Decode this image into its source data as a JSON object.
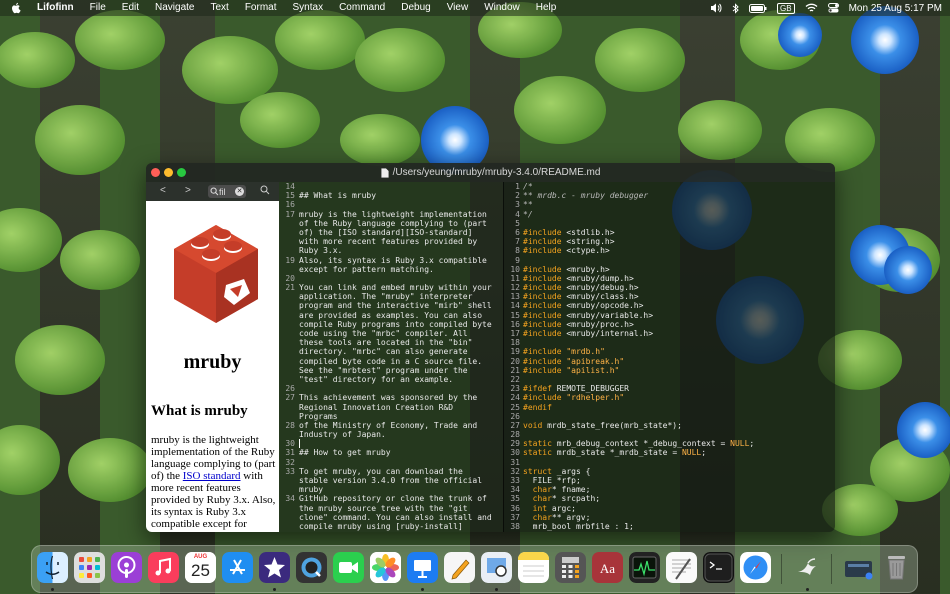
{
  "menubar": {
    "app_name": "Lifofinn",
    "menus": [
      "File",
      "Edit",
      "Navigate",
      "Text",
      "Format",
      "Syntax",
      "Command",
      "Debug",
      "View",
      "Window",
      "Help"
    ],
    "keyboard_layout": "GB",
    "clock": "Mon 25 Aug  5:17 PM"
  },
  "window": {
    "title": "/Users/yeung/mruby/mruby-3.4.0/README.md"
  },
  "preview": {
    "nav": {
      "back": "<",
      "forward": ">",
      "find_value": "fil"
    },
    "logo_title": "mruby",
    "heading": "What is mruby",
    "body_before_link1": "mruby is the lightweight implementation of the Ruby language complying to (part of) the ",
    "link1": "ISO standard",
    "body_after_link1": " with more recent features provided by Ruby 3.x. Also, its syntax is Ruby 3.x compatible except for"
  },
  "markdown_editor": {
    "lines": [
      {
        "n": "14",
        "t": ""
      },
      {
        "n": "15",
        "t": "## What is mruby"
      },
      {
        "n": "16",
        "t": ""
      },
      {
        "n": "17",
        "t": "mruby is the lightweight implementation"
      },
      {
        "n": "",
        "t": "of the Ruby language complying to (part"
      },
      {
        "n": "",
        "t": "of) the [ISO standard][ISO-standard]"
      },
      {
        "n": "",
        "t": "with more recent features provided by"
      },
      {
        "n": "",
        "t": "Ruby 3.x."
      },
      {
        "n": "19",
        "t": "Also, its syntax is Ruby 3.x compatible"
      },
      {
        "n": "",
        "t": "except for pattern matching."
      },
      {
        "n": "20",
        "t": ""
      },
      {
        "n": "21",
        "t": "You can link and embed mruby within your"
      },
      {
        "n": "",
        "t": "application. The \"mruby\" interpreter"
      },
      {
        "n": "",
        "t": "program and the interactive \"mirb\" shell"
      },
      {
        "n": "",
        "t": "are provided as examples. You can also"
      },
      {
        "n": "",
        "t": "compile Ruby programs into compiled byte"
      },
      {
        "n": "",
        "t": "code using the \"mrbc\" compiler. All"
      },
      {
        "n": "",
        "t": "these tools are located in the \"bin\""
      },
      {
        "n": "",
        "t": "directory. \"mrbc\" can also generate"
      },
      {
        "n": "",
        "t": "compiled byte code in a C source file."
      },
      {
        "n": "",
        "t": "See the \"mrbtest\" program under the"
      },
      {
        "n": "",
        "t": "\"test\" directory for an example."
      },
      {
        "n": "26",
        "t": ""
      },
      {
        "n": "27",
        "t": "This achievement was sponsored by the"
      },
      {
        "n": "",
        "t": "Regional Innovation Creation R&D"
      },
      {
        "n": "",
        "t": "Programs"
      },
      {
        "n": "28",
        "t": "of the Ministry of Economy, Trade and"
      },
      {
        "n": "",
        "t": "Industry of Japan."
      },
      {
        "n": "30",
        "t": ""
      },
      {
        "n": "31",
        "t": "## How to get mruby"
      },
      {
        "n": "32",
        "t": ""
      },
      {
        "n": "33",
        "t": "To get mruby, you can download the"
      },
      {
        "n": "",
        "t": "stable version 3.4.0 from the official"
      },
      {
        "n": "",
        "t": "mruby"
      },
      {
        "n": "34",
        "t": "GitHub repository or clone the trunk of"
      },
      {
        "n": "",
        "t": "the mruby source tree with the \"git"
      },
      {
        "n": "",
        "t": "clone\" command. You can also install and"
      },
      {
        "n": "",
        "t": "compile mruby using [ruby-install]"
      },
      {
        "n": "",
        "t": "(https://github.com/postmodern/ruby-"
      }
    ]
  },
  "c_editor": {
    "line_numbers": [
      "1",
      "2",
      "3",
      "4",
      "5",
      "6",
      "7",
      "8",
      "9",
      "10",
      "11",
      "12",
      "13",
      "14",
      "15",
      "16",
      "17",
      "18",
      "19",
      "20",
      "21",
      "22",
      "23",
      "24",
      "25",
      "26",
      "27",
      "28",
      "29",
      "30",
      "31",
      "32",
      "33",
      "34",
      "35",
      "36",
      "37",
      "38"
    ],
    "lines": [
      [
        {
          "c": "cm",
          "t": "/*"
        }
      ],
      [
        {
          "c": "cm",
          "t": "** mrdb.c - mruby debugger"
        }
      ],
      [
        {
          "c": "cm",
          "t": "**"
        }
      ],
      [
        {
          "c": "cm",
          "t": "*/"
        }
      ],
      [],
      [
        {
          "c": "inc",
          "t": "#include"
        },
        {
          "c": "",
          "t": " <stdlib.h>"
        }
      ],
      [
        {
          "c": "inc",
          "t": "#include"
        },
        {
          "c": "",
          "t": " <string.h>"
        }
      ],
      [
        {
          "c": "inc",
          "t": "#include"
        },
        {
          "c": "",
          "t": " <ctype.h>"
        }
      ],
      [],
      [
        {
          "c": "inc",
          "t": "#include"
        },
        {
          "c": "",
          "t": " <mruby.h>"
        }
      ],
      [
        {
          "c": "inc",
          "t": "#include"
        },
        {
          "c": "",
          "t": " <mruby/dump.h>"
        }
      ],
      [
        {
          "c": "inc",
          "t": "#include"
        },
        {
          "c": "",
          "t": " <mruby/debug.h>"
        }
      ],
      [
        {
          "c": "inc",
          "t": "#include"
        },
        {
          "c": "",
          "t": " <mruby/class.h>"
        }
      ],
      [
        {
          "c": "inc",
          "t": "#include"
        },
        {
          "c": "",
          "t": " <mruby/opcode.h>"
        }
      ],
      [
        {
          "c": "inc",
          "t": "#include"
        },
        {
          "c": "",
          "t": " <mruby/variable.h>"
        }
      ],
      [
        {
          "c": "inc",
          "t": "#include"
        },
        {
          "c": "",
          "t": " <mruby/proc.h>"
        }
      ],
      [
        {
          "c": "inc",
          "t": "#include"
        },
        {
          "c": "",
          "t": " <mruby/internal.h>"
        }
      ],
      [],
      [
        {
          "c": "inc",
          "t": "#include"
        },
        {
          "c": "str",
          "t": " \"mrdb.h\""
        }
      ],
      [
        {
          "c": "inc",
          "t": "#include"
        },
        {
          "c": "str",
          "t": " \"apibreak.h\""
        }
      ],
      [
        {
          "c": "inc",
          "t": "#include"
        },
        {
          "c": "str",
          "t": " \"apilist.h\""
        }
      ],
      [],
      [
        {
          "c": "inc",
          "t": "#ifdef"
        },
        {
          "c": "",
          "t": " REMOTE_DEBUGGER"
        }
      ],
      [
        {
          "c": "inc",
          "t": "#include"
        },
        {
          "c": "str",
          "t": " \"rdhelper.h\""
        }
      ],
      [
        {
          "c": "inc",
          "t": "#endif"
        }
      ],
      [],
      [
        {
          "c": "kw",
          "t": "void"
        },
        {
          "c": "",
          "t": " mrdb_state_free(mrb_state*);"
        }
      ],
      [],
      [
        {
          "c": "kw",
          "t": "static"
        },
        {
          "c": "",
          "t": " mrb_debug_context *_debug_context = "
        },
        {
          "c": "nul",
          "t": "NULL"
        },
        {
          "c": "",
          "t": ";"
        }
      ],
      [
        {
          "c": "kw",
          "t": "static"
        },
        {
          "c": "",
          "t": " mrdb_state *_mrdb_state = "
        },
        {
          "c": "nul",
          "t": "NULL"
        },
        {
          "c": "",
          "t": ";"
        }
      ],
      [],
      [
        {
          "c": "kw",
          "t": "struct"
        },
        {
          "c": "",
          "t": " _args {"
        }
      ],
      [
        {
          "c": "",
          "t": "  FILE *rfp;"
        }
      ],
      [
        {
          "c": "",
          "t": "  "
        },
        {
          "c": "kw",
          "t": "char"
        },
        {
          "c": "",
          "t": "* fname;"
        }
      ],
      [
        {
          "c": "",
          "t": "  "
        },
        {
          "c": "kw",
          "t": "char"
        },
        {
          "c": "",
          "t": "* srcpath;"
        }
      ],
      [
        {
          "c": "",
          "t": "  "
        },
        {
          "c": "kw",
          "t": "int"
        },
        {
          "c": "",
          "t": " argc;"
        }
      ],
      [
        {
          "c": "",
          "t": "  "
        },
        {
          "c": "kw",
          "t": "char"
        },
        {
          "c": "",
          "t": "** argv;"
        }
      ],
      [
        {
          "c": "",
          "t": "  mrb_bool mrbfile : 1;"
        }
      ]
    ]
  },
  "dock": {
    "calendar": {
      "month": "AUG",
      "day": "25"
    },
    "apps": [
      "Finder",
      "Launchpad",
      "Podcasts",
      "Music",
      "Calendar",
      "App Store",
      "iMovie",
      "QuickTime Player",
      "FaceTime",
      "Photos",
      "Keynote",
      "Notes Pencil",
      "Preview",
      "Notes",
      "Calculator",
      "Dictionary",
      "Activity Monitor",
      "TextEdit",
      "Terminal",
      "Safari",
      "Lifofinn",
      "Downloads",
      "Trash"
    ]
  }
}
